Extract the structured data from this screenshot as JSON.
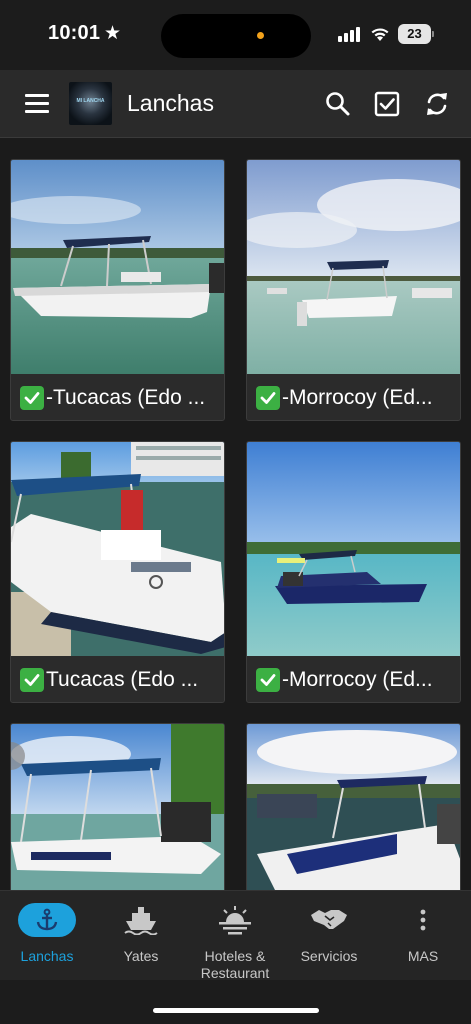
{
  "status_bar": {
    "time": "10:01",
    "battery": "23"
  },
  "app_bar": {
    "title": "Lanchas",
    "logo_text": "MI LANCHA"
  },
  "listings": [
    {
      "title": "-Tucacas (Edo ..."
    },
    {
      "title": "-Morrocoy (Ed..."
    },
    {
      "title": "Tucacas (Edo ..."
    },
    {
      "title": "-Morrocoy (Ed..."
    },
    {
      "title": ""
    },
    {
      "title": ""
    }
  ],
  "bottom_nav": [
    {
      "label": "Lanchas",
      "icon": "anchor-icon",
      "active": true
    },
    {
      "label": "Yates",
      "icon": "ship-icon",
      "active": false
    },
    {
      "label": "Hoteles & Restaurant",
      "icon": "sunset-icon",
      "active": false
    },
    {
      "label": "Servicios",
      "icon": "handshake-icon",
      "active": false
    },
    {
      "label": "MAS",
      "icon": "more-vertical-icon",
      "active": false
    }
  ],
  "colors": {
    "accent": "#1da1dc",
    "check_green": "#3cb043"
  }
}
